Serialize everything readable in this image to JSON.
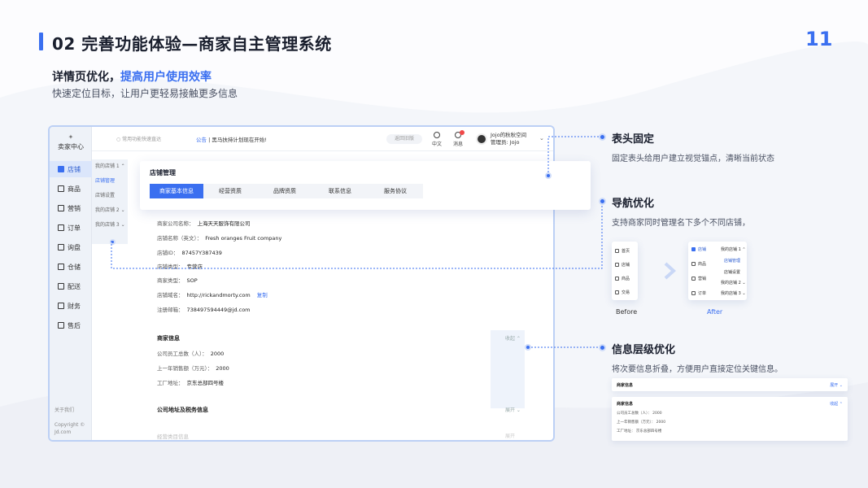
{
  "slide": {
    "title": "02 完善功能体验—商家自主管理系统",
    "page_number": "11",
    "subtitle_plain": "详情页优化，",
    "subtitle_highlight": "提高用户使用效率",
    "description": "快速定位目标，让用户更轻易接触更多信息"
  },
  "mock": {
    "logo_text": "卖家中心",
    "sidebar": [
      {
        "label": "店铺",
        "active": true
      },
      {
        "label": "商品"
      },
      {
        "label": "营销"
      },
      {
        "label": "订单"
      },
      {
        "label": "询盘"
      },
      {
        "label": "仓储"
      },
      {
        "label": "配送"
      },
      {
        "label": "财务"
      },
      {
        "label": "售后"
      }
    ],
    "footer_about": "关于我们",
    "footer_copyright_1": "Copyright ©",
    "footer_copyright_2": "Jd.com",
    "search_placeholder": "常用功能快速直达",
    "notice_tag": "公告",
    "notice_text": "黑马扶持计划现在开始!",
    "back_button": "返回旧版",
    "icon_lang": "中文",
    "icon_msg": "消息",
    "user_name": "Jojo的秋秋空间",
    "user_role": "管理员: Jojo",
    "sub_nav": [
      "我的店铺 1  ⌃",
      "店铺管理",
      "店铺设置",
      "我的店铺 2  ⌄",
      "我的店铺 3  ⌄"
    ],
    "sticky_title": "店铺管理",
    "tabs": [
      "商家基本信息",
      "经营资质",
      "品牌资质",
      "联系信息",
      "服务协议"
    ],
    "fields": [
      {
        "label": "商家公司名称：",
        "value": "上海天天服饰有限公司"
      },
      {
        "label": "店铺名称（英文）：",
        "value": "Fresh oranges Fruit company"
      },
      {
        "label": "店铺ID：",
        "value": "87457Y387439"
      },
      {
        "label": "店铺类型：",
        "value": "专营店"
      },
      {
        "label": "商家类型：",
        "value": "SOP"
      },
      {
        "label": "店铺域名：",
        "value": "http://rickandmorty.com",
        "link": "复制"
      },
      {
        "label": "注册邮箱：",
        "value": "738497594449@jd.com"
      }
    ],
    "section1_title": "商家信息",
    "section1_toggle": "收起  ⌃",
    "section1_fields": [
      {
        "label": "公司员工总数（人）：",
        "value": "2000"
      },
      {
        "label": "上一年销售额（万元）：",
        "value": "2000"
      },
      {
        "label": "工厂地址：",
        "value": "京东总部四号楼"
      }
    ],
    "section2_title": "公司地址及税务信息",
    "section2_toggle": "展开  ⌄",
    "section3_title": "经营类目信息",
    "section3_toggle": "展开"
  },
  "annotations": [
    {
      "title": "表头固定",
      "desc": "固定表头给用户建立视觉锚点，清晰当前状态"
    },
    {
      "title": "导航优化",
      "desc": "支持商家同时管理名下多个不同店铺，"
    },
    {
      "title": "信息层级优化",
      "desc": "将次要信息折叠，方便用户直接定位关键信息。"
    }
  ],
  "before_after": {
    "before_label": "Before",
    "after_label": "After",
    "before_items": [
      "首页",
      "店铺",
      "商品",
      "交易"
    ],
    "after_items": [
      "店铺",
      "商品",
      "营销",
      "订单"
    ],
    "after_sub": [
      "我的店铺 1  ⌃",
      "店铺管理",
      "店铺设置",
      "我的店铺 2  ⌄",
      "我的店铺 3  ⌄"
    ]
  },
  "example": {
    "collapsed_title": "商家信息",
    "collapsed_toggle": "展开  ⌄",
    "expanded_title": "商家信息",
    "expanded_toggle": "收起  ⌃",
    "rows": [
      "公司员工总数（人）：  2000",
      "上一年销售额（万元）：  2000",
      "工厂地址：  京东总部四号楼"
    ]
  },
  "colors": {
    "accent": "#3a6ff0"
  }
}
